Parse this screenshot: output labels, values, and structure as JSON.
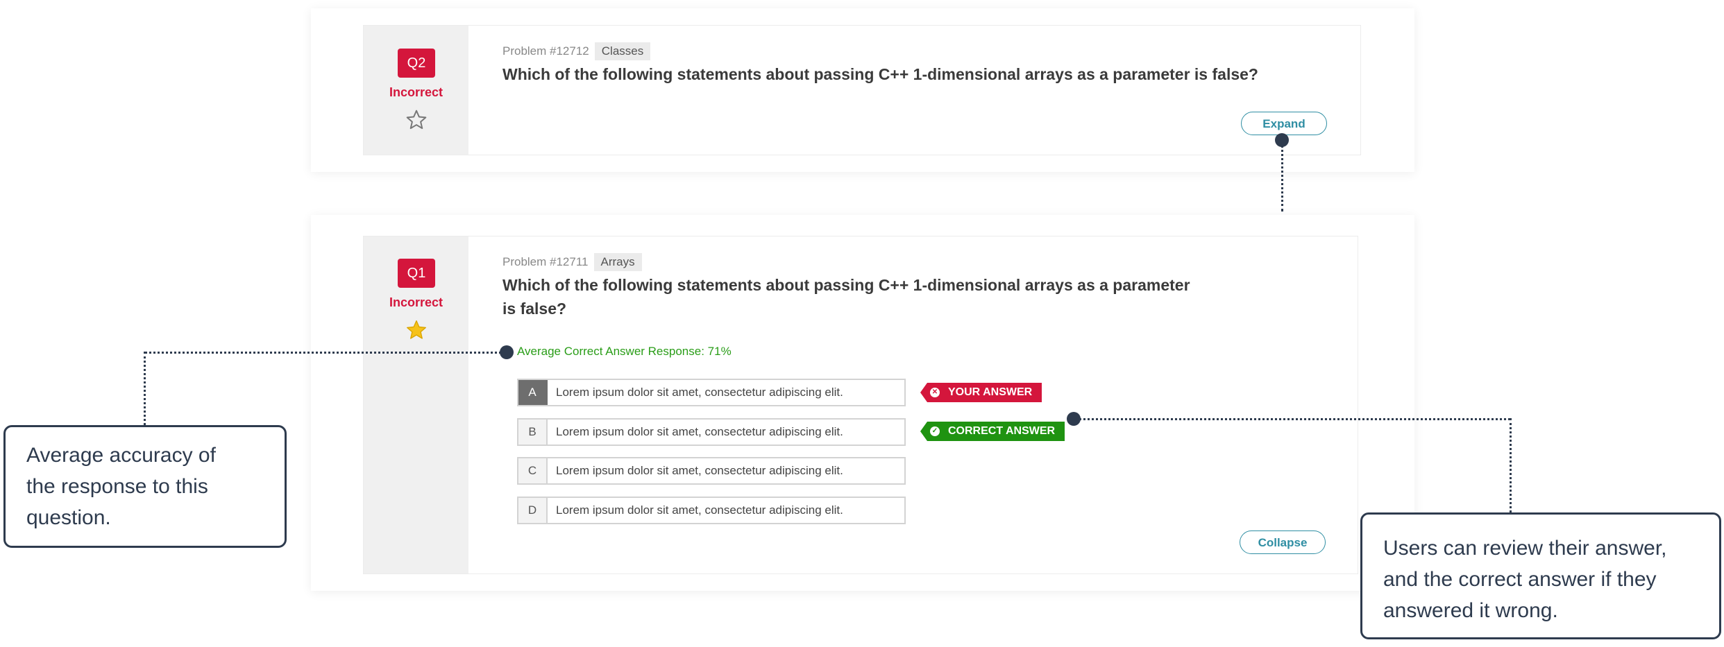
{
  "q2": {
    "badge": "Q2",
    "status": "Incorrect",
    "problem": "Problem #12712",
    "tag": "Classes",
    "question": "Which of the following statements about passing C++ 1-dimensional arrays as a parameter is false?",
    "button": "Expand",
    "starred": false
  },
  "q1": {
    "badge": "Q1",
    "status": "Incorrect",
    "problem": "Problem #12711",
    "tag": "Arrays",
    "question_line1": "Which of the following statements about passing C++ 1-dimensional arrays as a parameter",
    "question_line2": "is false?",
    "avg_label": "Average Correct Answer Response: 71%",
    "options": [
      {
        "letter": "A",
        "text": "Lorem ipsum dolor sit amet, consectetur adipiscing elit."
      },
      {
        "letter": "B",
        "text": "Lorem ipsum dolor sit amet, consectetur adipiscing elit."
      },
      {
        "letter": "C",
        "text": "Lorem ipsum dolor sit amet, consectetur adipiscing elit."
      },
      {
        "letter": "D",
        "text": "Lorem ipsum dolor sit amet, consectetur adipiscing elit."
      }
    ],
    "your_answer_label": "YOUR ANSWER",
    "correct_answer_label": "CORRECT ANSWER",
    "button": "Collapse",
    "starred": true
  },
  "annotations": {
    "left": {
      "line1": "Average accuracy of",
      "line2": "the response to this",
      "line3": "question."
    },
    "right": {
      "line1": "Users can review their answer,",
      "line2": "and the correct answer if they",
      "line3": "answered it wrong."
    }
  },
  "colors": {
    "accent_red": "#d4163c",
    "accent_green": "#1f9311",
    "accent_teal": "#2f8ea3",
    "annotation": "#2e3b4e"
  },
  "icons": {
    "star_empty": "star-outline-icon",
    "star_filled": "star-filled-icon",
    "wrong": "x-circle-icon",
    "correct": "check-circle-icon"
  }
}
